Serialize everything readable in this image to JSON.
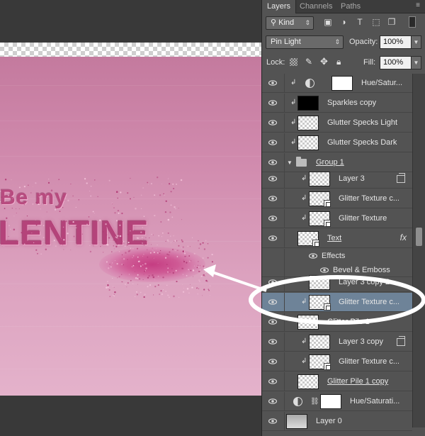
{
  "canvas": {
    "line1": "Be my",
    "line2": "LENTINE"
  },
  "panel": {
    "tabs": [
      "Layers",
      "Channels",
      "Paths"
    ],
    "filter_label": "Kind",
    "blend_mode": "Pin Light",
    "opacity_label": "Opacity:",
    "opacity_value": "100%",
    "lock_label": "Lock:",
    "fill_label": "Fill:",
    "fill_value": "100%"
  },
  "layers": [
    {
      "name": "Hue/Satur...",
      "kind": "adjustment"
    },
    {
      "name": "Sparkles copy",
      "kind": "black"
    },
    {
      "name": "Glutter Specks Light",
      "kind": "layer"
    },
    {
      "name": "Glutter Specks Dark",
      "kind": "layer"
    },
    {
      "name": "Group 1",
      "kind": "group"
    },
    {
      "name": "Layer 3",
      "kind": "layer"
    },
    {
      "name": "Glitter Texture c...",
      "kind": "smart"
    },
    {
      "name": "Glitter Texture",
      "kind": "smart"
    },
    {
      "name": "Text",
      "kind": "smart"
    },
    {
      "name": "Effects",
      "kind": "effects"
    },
    {
      "name": "Bevel & Emboss",
      "kind": "effect"
    },
    {
      "name": "Layer 3 copy 2",
      "kind": "layer"
    },
    {
      "name": "Glitter Texture c...",
      "kind": "smart",
      "selected": true
    },
    {
      "name": "Glitter Pile 1",
      "kind": "layer"
    },
    {
      "name": "Layer 3 copy",
      "kind": "layer"
    },
    {
      "name": "Glitter Texture c...",
      "kind": "smart"
    },
    {
      "name": "Glitter Pile 1 copy",
      "kind": "layer"
    },
    {
      "name": "Hue/Saturati...",
      "kind": "adjustment"
    },
    {
      "name": "Layer 0",
      "kind": "background"
    }
  ]
}
